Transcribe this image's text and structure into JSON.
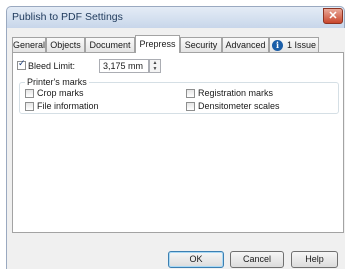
{
  "window": {
    "title": "Publish to PDF Settings",
    "close_glyph": "✕"
  },
  "tabs": [
    {
      "label": "General"
    },
    {
      "label": "Objects"
    },
    {
      "label": "Document"
    },
    {
      "label": "Prepress",
      "active": true
    },
    {
      "label": "Security"
    },
    {
      "label": "Advanced"
    },
    {
      "label": "1 Issue",
      "icon": "info-icon"
    }
  ],
  "prepress": {
    "bleed_limit": {
      "label": "Bleed Limit:",
      "checked": true,
      "value": "3,175 mm"
    },
    "printers_marks": {
      "legend": "Printer's marks",
      "crop_marks": {
        "label": "Crop marks",
        "checked": false
      },
      "file_information": {
        "label": "File information",
        "checked": false
      },
      "registration_marks": {
        "label": "Registration marks",
        "checked": false
      },
      "densitometer_scales": {
        "label": "Densitometer scales",
        "checked": false
      }
    }
  },
  "buttons": {
    "ok": "OK",
    "cancel": "Cancel",
    "help": "Help"
  },
  "colors": {
    "accent": "#1b5ea8",
    "close": "#c9462c",
    "title_text": "#1e395b"
  }
}
